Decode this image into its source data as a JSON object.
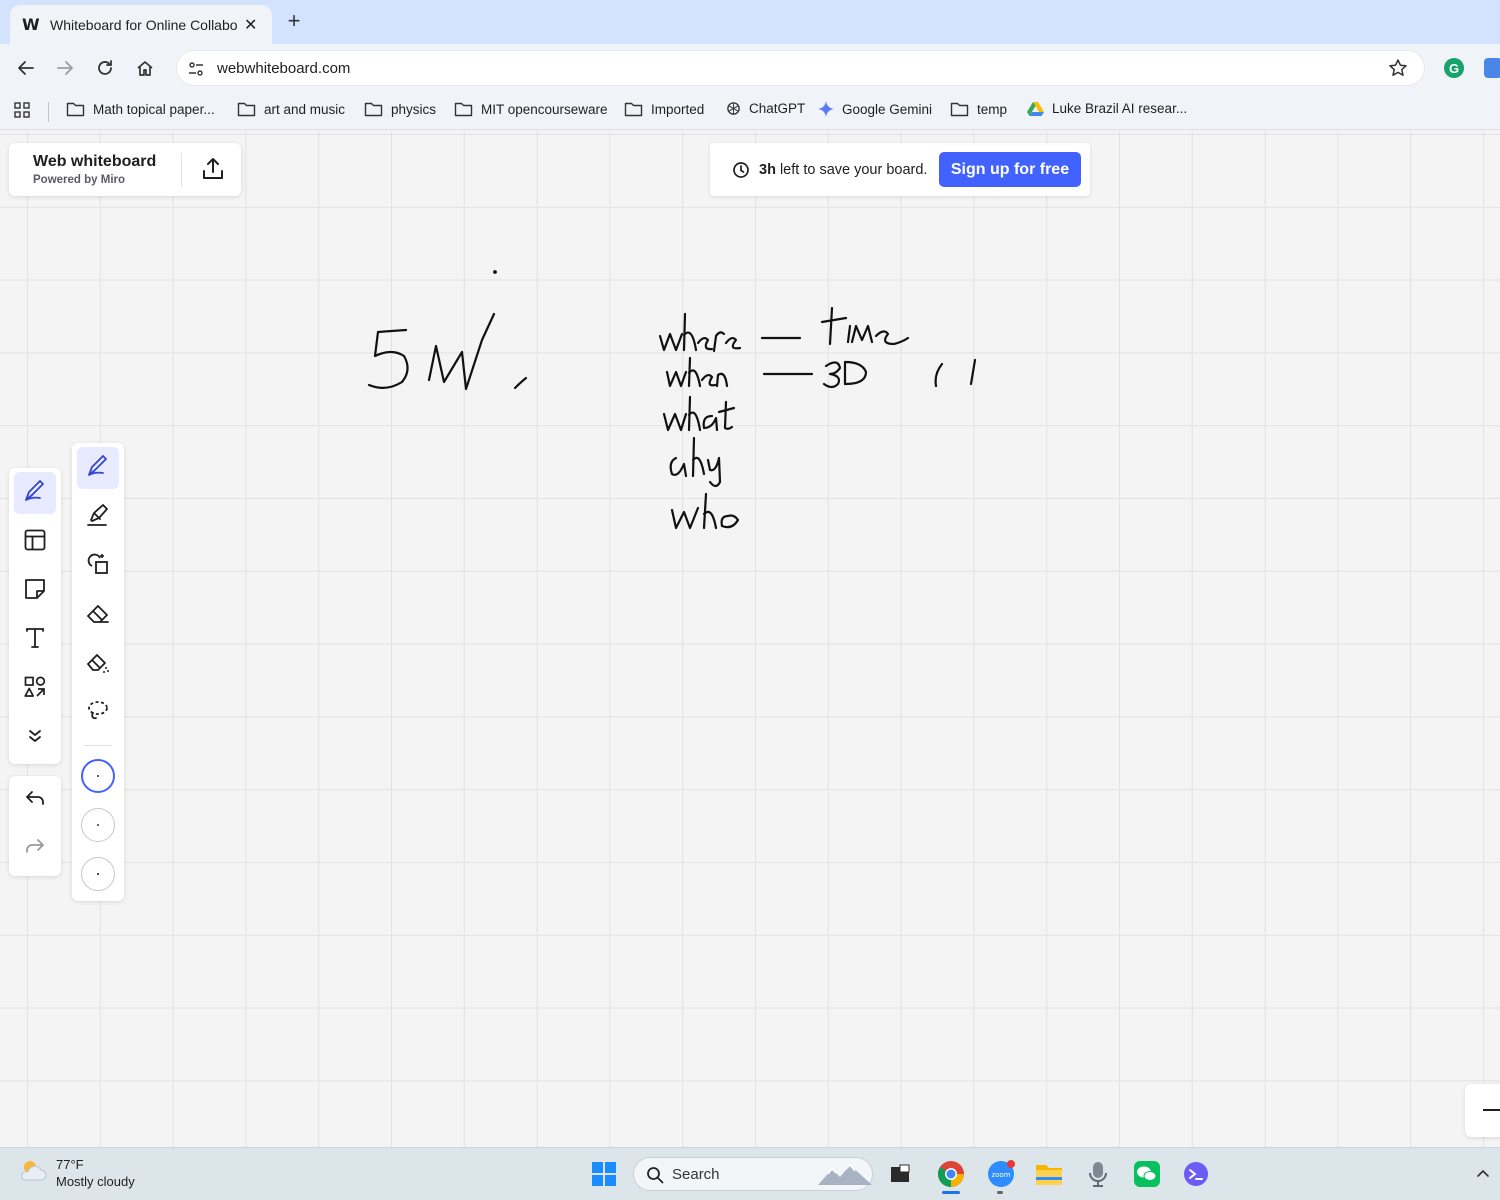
{
  "browser": {
    "tab": {
      "favicon": "W",
      "title": "Whiteboard for Online Collaboration"
    },
    "url": "webwhiteboard.com",
    "bookmarks": [
      {
        "label": "Math topical paper...",
        "icon": "folder-icon"
      },
      {
        "label": "art and music",
        "icon": "folder-icon"
      },
      {
        "label": "physics",
        "icon": "folder-icon"
      },
      {
        "label": "MIT opencourseware",
        "icon": "folder-icon"
      },
      {
        "label": "Imported",
        "icon": "folder-icon"
      },
      {
        "label": "ChatGPT",
        "icon": "chatgpt-icon"
      },
      {
        "label": "Google Gemini",
        "icon": "gemini-icon"
      },
      {
        "label": "temp",
        "icon": "folder-icon"
      },
      {
        "label": "Luke Brazil AI resear...",
        "icon": "google-drive-icon"
      }
    ]
  },
  "board": {
    "title": "Web whiteboard",
    "subtitle": "Powered by Miro"
  },
  "save_banner": {
    "time": "3h",
    "text": " left to save your board.",
    "button": "Sign up for free"
  },
  "toolbar": {
    "tools": [
      "pen-icon",
      "templates-icon",
      "sticky-note-icon",
      "text-icon",
      "shapes-icon",
      "more-tools-icon"
    ],
    "history": [
      "undo-icon",
      "redo-icon"
    ],
    "pen_tools": [
      "pen-icon",
      "highlighter-icon",
      "smart-shape-icon",
      "eraser-icon",
      "object-eraser-icon",
      "lasso-icon"
    ],
    "selected_size": 1
  },
  "handwriting": [
    "5W",
    "where — time",
    "when — 30",
    "what",
    "why",
    "who"
  ],
  "taskbar": {
    "weather_temp": "77°F",
    "weather_desc": "Mostly cloudy",
    "search_placeholder": "Search"
  },
  "colors": {
    "accent": "#4262ff",
    "ink": "#111111"
  }
}
